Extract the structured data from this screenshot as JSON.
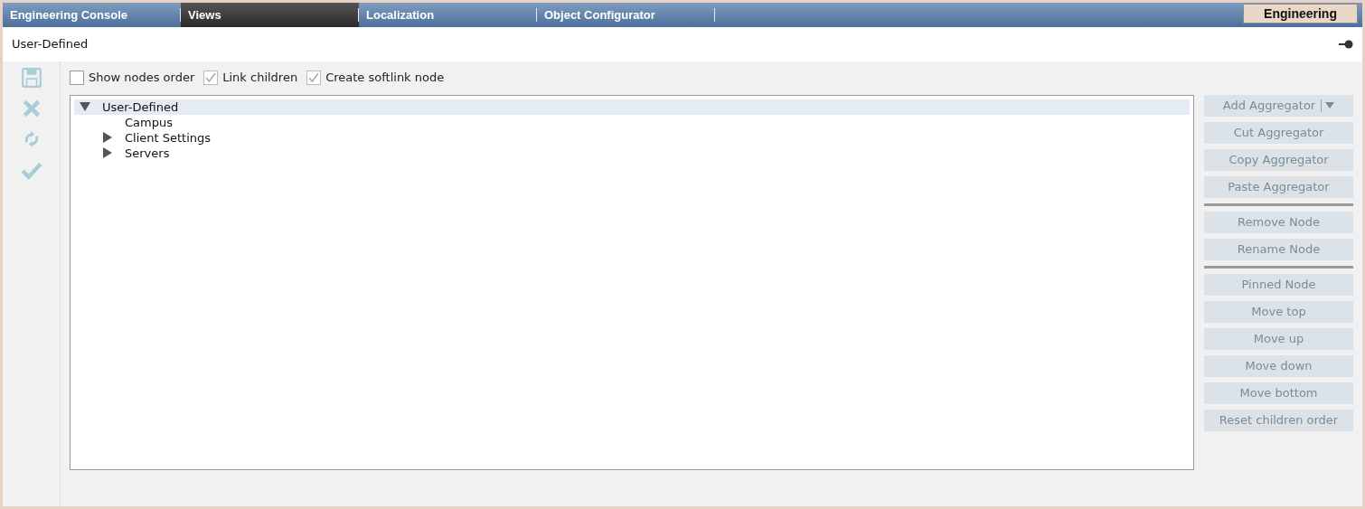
{
  "tabs": [
    {
      "label": "Engineering Console",
      "selected": false
    },
    {
      "label": "Views",
      "selected": true
    },
    {
      "label": "Localization",
      "selected": false
    },
    {
      "label": "Object Configurator",
      "selected": false
    }
  ],
  "mode_badge": "Engineering",
  "header": {
    "title": "User-Defined"
  },
  "toolbar": [
    {
      "kind": "save",
      "disabled": true
    },
    {
      "kind": "cancel",
      "disabled": true
    },
    {
      "kind": "refresh",
      "disabled": true
    },
    {
      "kind": "apply",
      "disabled": true
    }
  ],
  "options": [
    {
      "label": "Show nodes order",
      "checked": false,
      "disabled": false
    },
    {
      "label": "Link children",
      "checked": true,
      "disabled": true
    },
    {
      "label": "Create softlink node",
      "checked": true,
      "disabled": true
    }
  ],
  "tree": [
    {
      "label": "User-Defined",
      "expanded": true,
      "selected": true,
      "children": [
        {
          "label": "Campus",
          "selected": false
        },
        {
          "label": "Client Settings",
          "expanded": false,
          "selected": false
        },
        {
          "label": "Servers",
          "expanded": false,
          "selected": false
        }
      ]
    }
  ],
  "button_groups": [
    [
      {
        "label": "Add Aggregator",
        "kind": "split",
        "disabled": true
      },
      {
        "label": "Cut Aggregator",
        "kind": "plain",
        "disabled": true
      },
      {
        "label": "Copy Aggregator",
        "kind": "plain",
        "disabled": true
      },
      {
        "label": "Paste Aggregator",
        "kind": "plain",
        "disabled": true
      }
    ],
    [
      {
        "label": "Remove Node",
        "kind": "plain",
        "disabled": true
      },
      {
        "label": "Rename Node",
        "kind": "plain",
        "disabled": true
      }
    ],
    [
      {
        "label": "Pinned Node",
        "kind": "plain",
        "disabled": true
      },
      {
        "label": "Move top",
        "kind": "plain",
        "disabled": true
      },
      {
        "label": "Move up",
        "kind": "plain",
        "disabled": true
      },
      {
        "label": "Move down",
        "kind": "plain",
        "disabled": true
      },
      {
        "label": "Move bottom",
        "kind": "plain",
        "disabled": true
      },
      {
        "label": "Reset children order",
        "kind": "plain",
        "disabled": true
      }
    ]
  ]
}
